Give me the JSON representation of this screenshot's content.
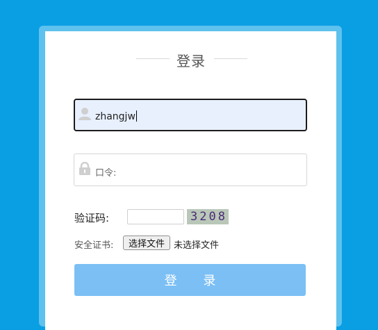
{
  "login": {
    "title": "登录",
    "username_value": "zhangjw",
    "password_placeholder": "口令:",
    "captcha_label": "验证码:",
    "captcha_input_value": "",
    "captcha_code": "3208",
    "cert_label": "安全证书:",
    "file_button_label": "选择文件",
    "file_status": "未选择文件",
    "submit_label": "登 录"
  },
  "icons": {
    "user": "user-icon",
    "lock": "lock-icon"
  },
  "colors": {
    "background": "#0a9fe3",
    "frame": "#5ec1ee",
    "submit": "#7bbff5",
    "focused_field": "#e8f0fe"
  }
}
